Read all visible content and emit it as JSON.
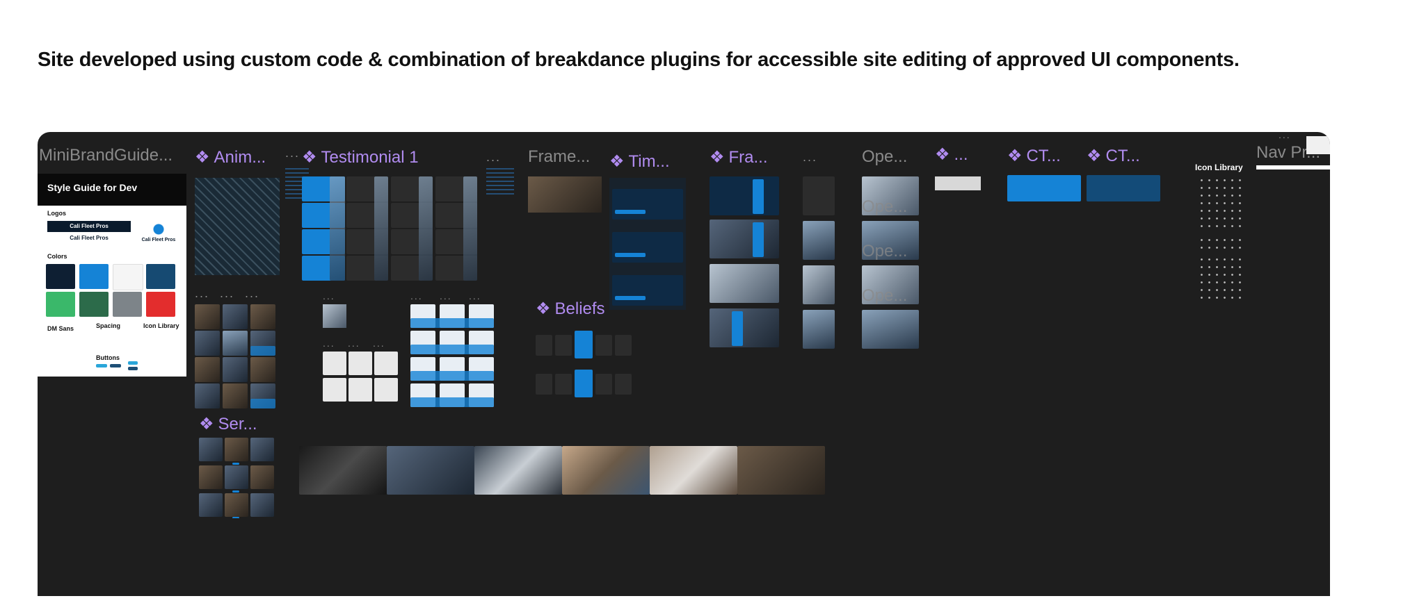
{
  "headline": "Site developed using custom code & combination of breakdance plugins for accessible site editing of approved UI components.",
  "diamond": "❖",
  "ellipsis": "...",
  "frames": {
    "mini_brand_guide": "MiniBrandGuide...",
    "anim": "Anim...",
    "testimonial": "Testimonial 1",
    "frame": "Frame...",
    "tim": "Tim...",
    "fra": "Fra...",
    "ope": "Ope...",
    "cta1": "CT...",
    "cta2": "CT...",
    "icon_library": "Icon Library",
    "nav": "Nav Pr...",
    "beliefs": "Beliefs",
    "ser": "Ser..."
  },
  "style_guide": {
    "title": "Style Guide for Dev",
    "logos": "Logos",
    "brand": "Cali Fleet Pros",
    "colors": "Colors",
    "font": "DM Sans",
    "spacing": "Spacing",
    "icon_library": "Icon Library",
    "buttons": "Buttons"
  },
  "overlay_labels": {
    "ope_a": "Ope...",
    "ope_b": "Ope...",
    "ope_c": "Ope..."
  },
  "colors": {
    "canvas": "#1e1e1e",
    "component_purple": "#b18cf0",
    "frame_gray": "#8a8a8a",
    "brand_blue": "#1583d6",
    "navy": "#0e2a45"
  }
}
